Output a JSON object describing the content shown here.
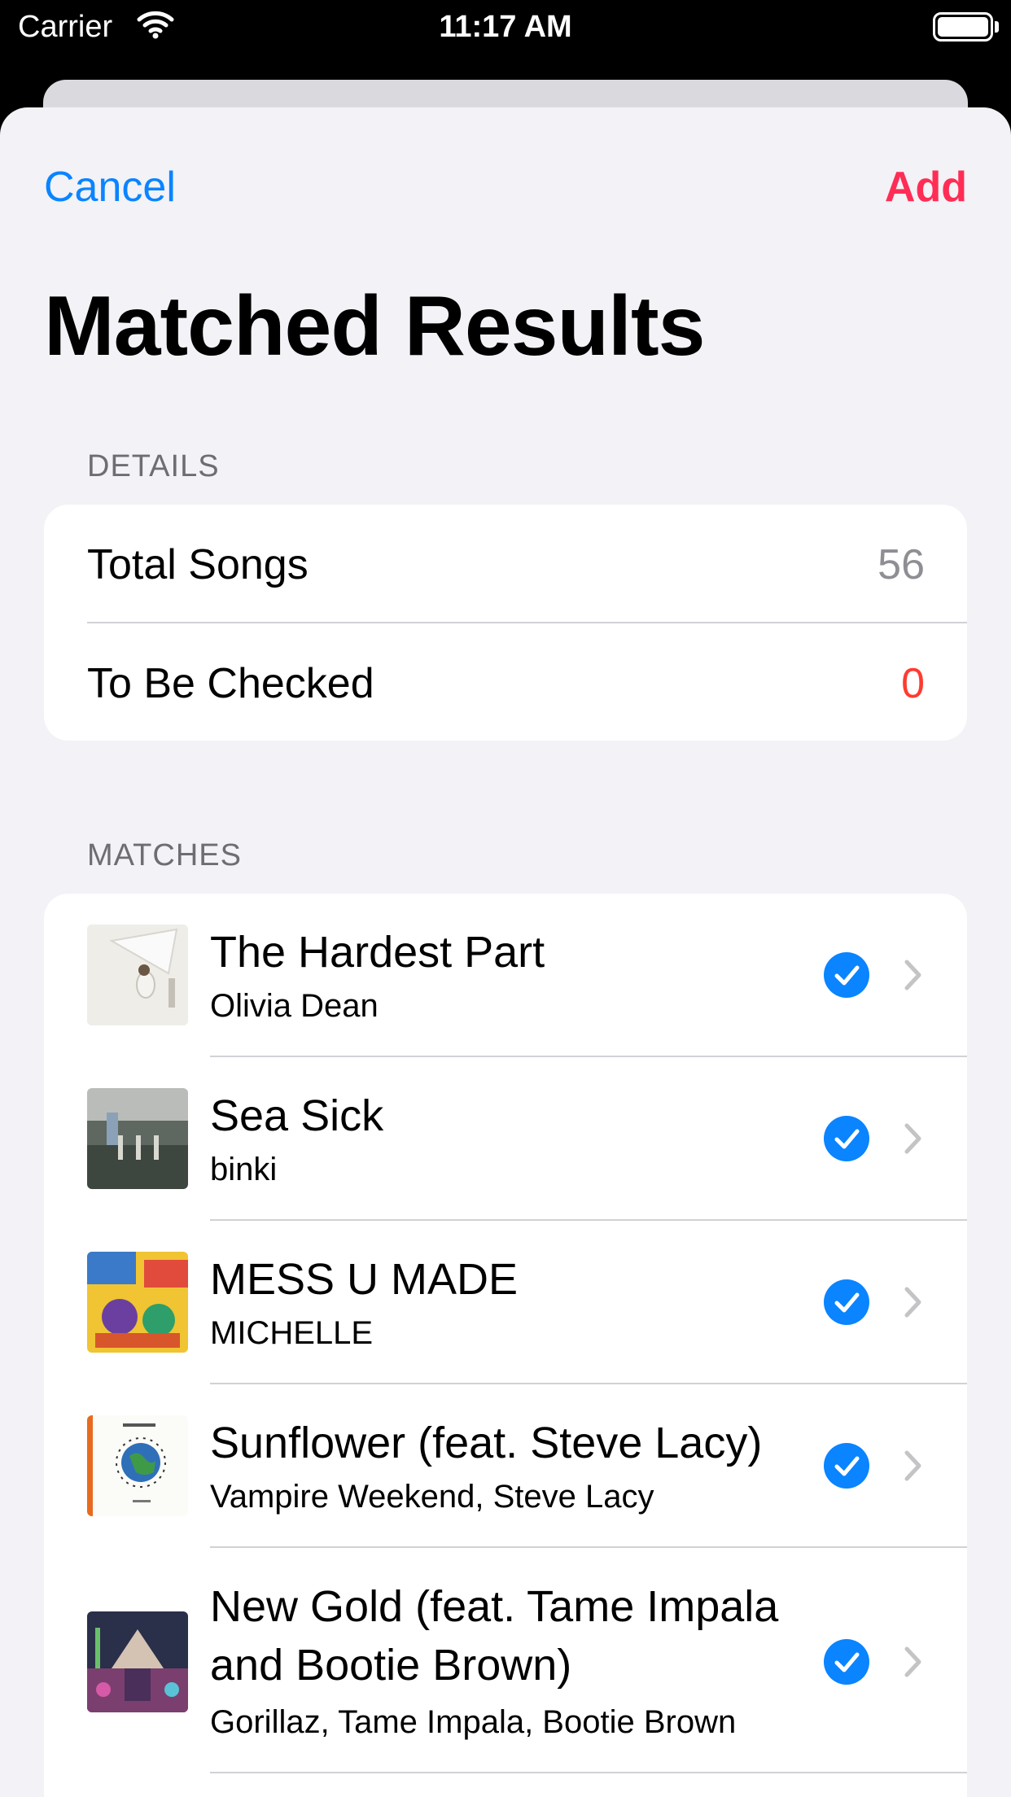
{
  "status_bar": {
    "carrier": "Carrier",
    "time": "11:17 AM"
  },
  "nav": {
    "cancel": "Cancel",
    "add": "Add"
  },
  "title": "Matched Results",
  "details": {
    "header": "DETAILS",
    "rows": [
      {
        "label": "Total Songs",
        "value": "56",
        "color": "#8e8e93"
      },
      {
        "label": "To Be Checked",
        "value": "0",
        "color": "#ff3b30"
      }
    ]
  },
  "matches": {
    "header": "MATCHES",
    "songs": [
      {
        "title": "The Hardest Part",
        "artist": "Olivia Dean",
        "checked": true
      },
      {
        "title": "Sea Sick",
        "artist": "binki",
        "checked": true
      },
      {
        "title": "MESS U MADE",
        "artist": "MICHELLE",
        "checked": true
      },
      {
        "title": "Sunflower (feat. Steve Lacy)",
        "artist": "Vampire Weekend, Steve Lacy",
        "checked": true
      },
      {
        "title": "New Gold (feat. Tame Impala and Bootie Brown)",
        "artist": "Gorillaz, Tame Impala, Bootie Brown",
        "checked": true
      }
    ]
  },
  "colors": {
    "accent": "#0a84ff",
    "add": "#ff2d55",
    "background": "#f2f2f7"
  }
}
